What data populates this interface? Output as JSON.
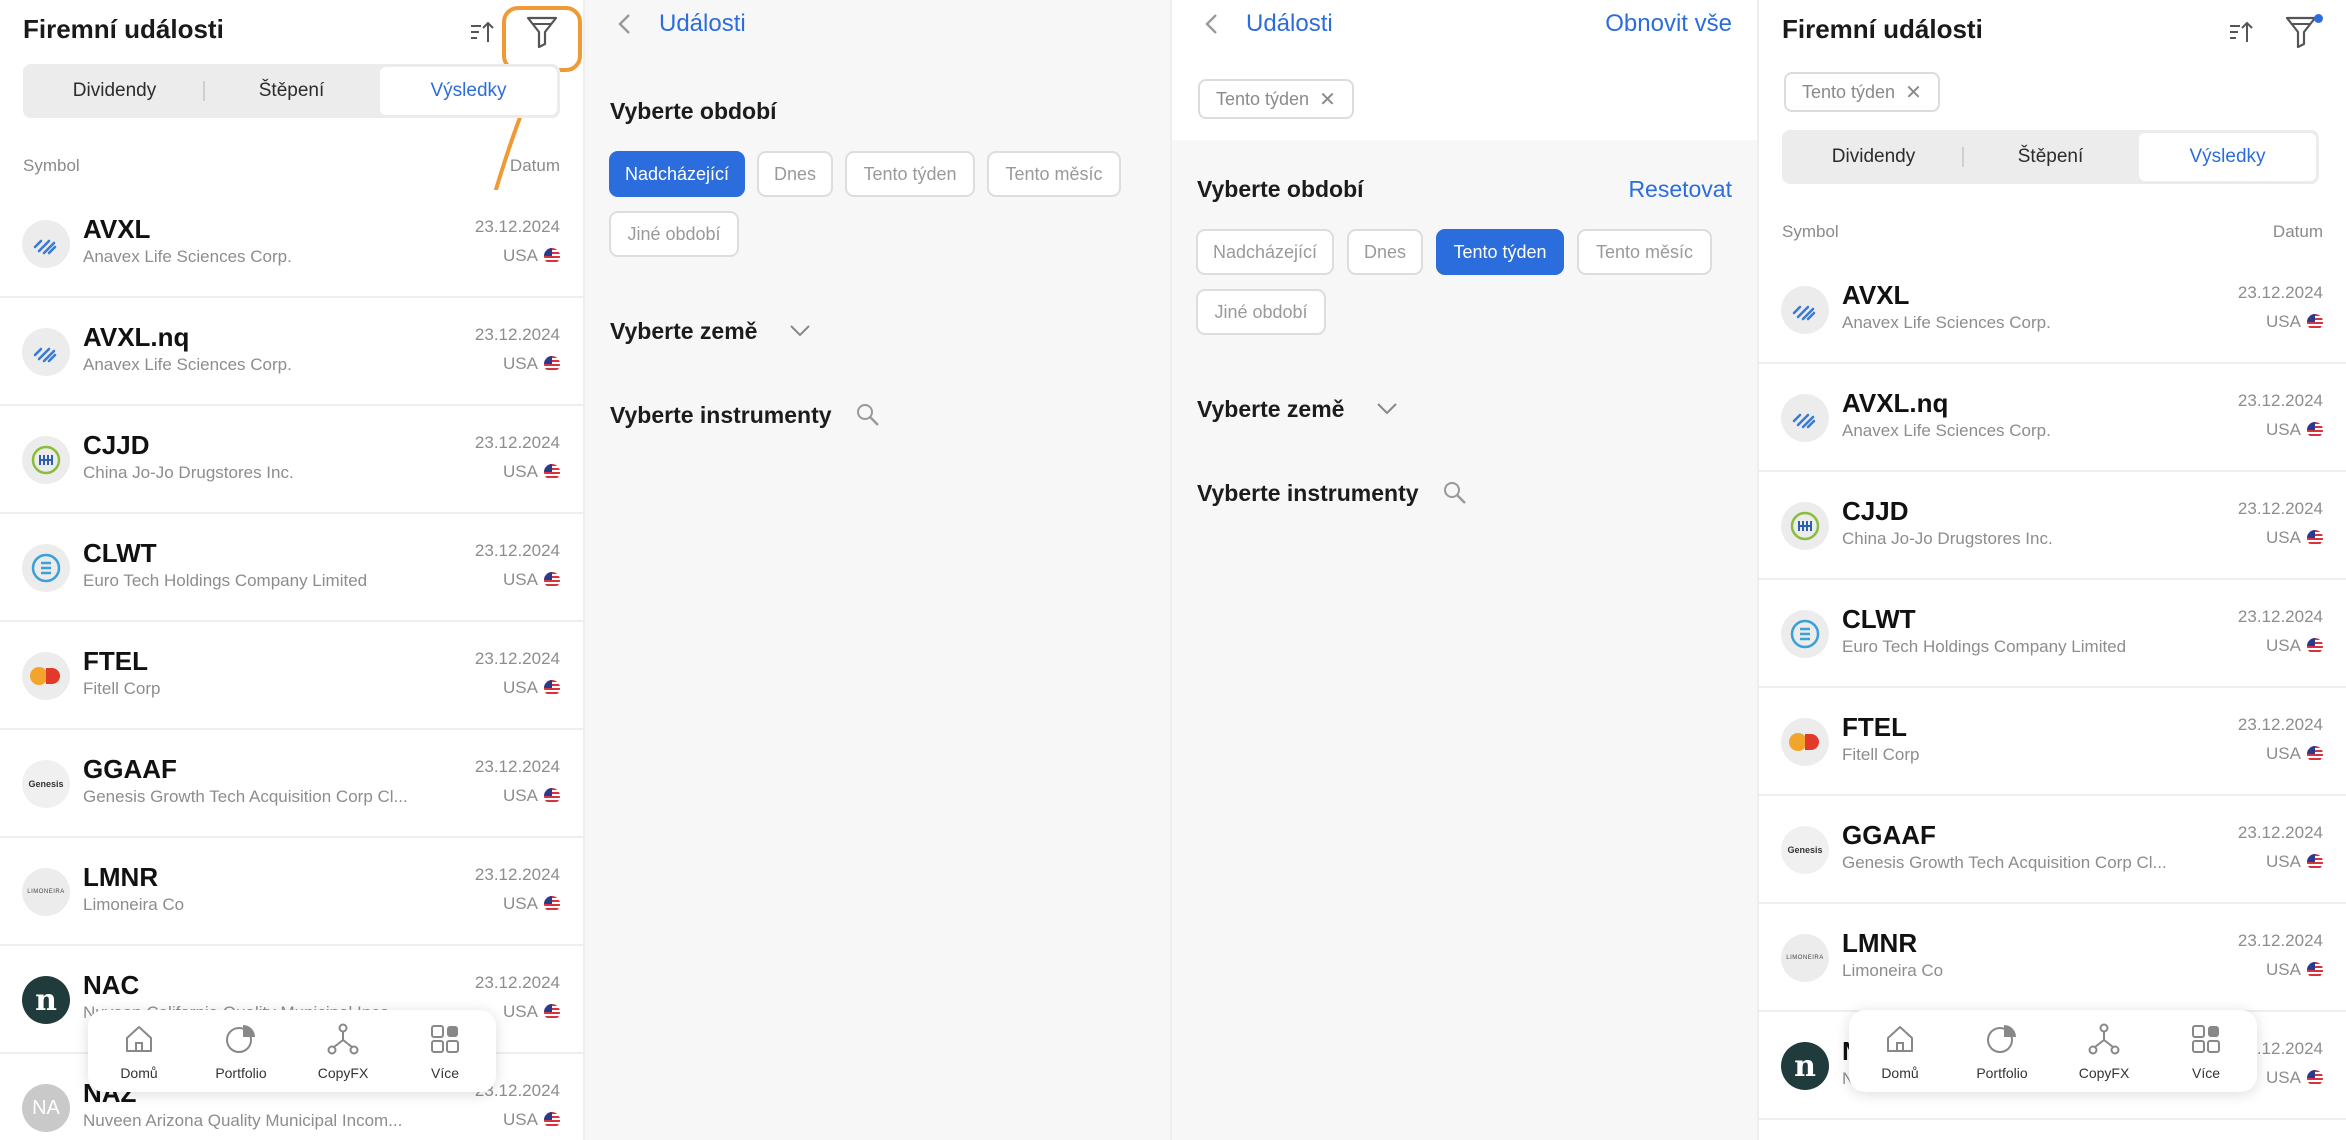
{
  "list": {
    "title": "Firemní události",
    "tabs": [
      "Dividendy",
      "Štěpení",
      "Výsledky"
    ],
    "active_tab": "Výsledky",
    "col_symbol": "Symbol",
    "col_date": "Datum",
    "active_chip": "Tento týden",
    "rows": [
      {
        "symbol": "AVXL",
        "name": "Anavex Life Sciences Corp.",
        "date": "23.12.2024",
        "country": "USA"
      },
      {
        "symbol": "AVXL.nq",
        "name": "Anavex Life Sciences Corp.",
        "date": "23.12.2024",
        "country": "USA"
      },
      {
        "symbol": "CJJD",
        "name": "China Jo-Jo Drugstores Inc.",
        "date": "23.12.2024",
        "country": "USA"
      },
      {
        "symbol": "CLWT",
        "name": "Euro Tech Holdings Company Limited",
        "date": "23.12.2024",
        "country": "USA"
      },
      {
        "symbol": "FTEL",
        "name": "Fitell Corp",
        "date": "23.12.2024",
        "country": "USA"
      },
      {
        "symbol": "GGAAF",
        "name": "Genesis Growth Tech Acquisition Corp Cl...",
        "date": "23.12.2024",
        "country": "USA"
      },
      {
        "symbol": "LMNR",
        "name": "Limoneira Co",
        "date": "23.12.2024",
        "country": "USA"
      },
      {
        "symbol": "NAC",
        "name": "Nuveen California Quality Municipal Inco...",
        "date": "23.12.2024",
        "country": "USA"
      },
      {
        "symbol": "NAZ",
        "name": "Nuveen Arizona Quality Municipal Incom...",
        "date": "23.12.2024",
        "country": "USA"
      }
    ],
    "logo_texts": {
      "GGAAF": "Genesis",
      "LMNR": "LIMONEIRA",
      "NAC": "n",
      "NAZ": "NA"
    }
  },
  "nav": {
    "home": "Domů",
    "portfolio": "Portfolio",
    "copyfx": "CopyFX",
    "more": "Více"
  },
  "filter": {
    "header_title": "Události",
    "reset_all": "Obnovit vše",
    "period_label": "Vyberte období",
    "reset": "Resetovat",
    "period_options": [
      "Nadcházející",
      "Dnes",
      "Tento týden",
      "Tento měsíc",
      "Jiné období"
    ],
    "country_label": "Vyberte země",
    "instruments_label": "Vyberte instrumenty",
    "selected_chip": "Tento týden"
  },
  "colors": {
    "accent": "#2b6ddc",
    "highlight": "#f09a36"
  }
}
